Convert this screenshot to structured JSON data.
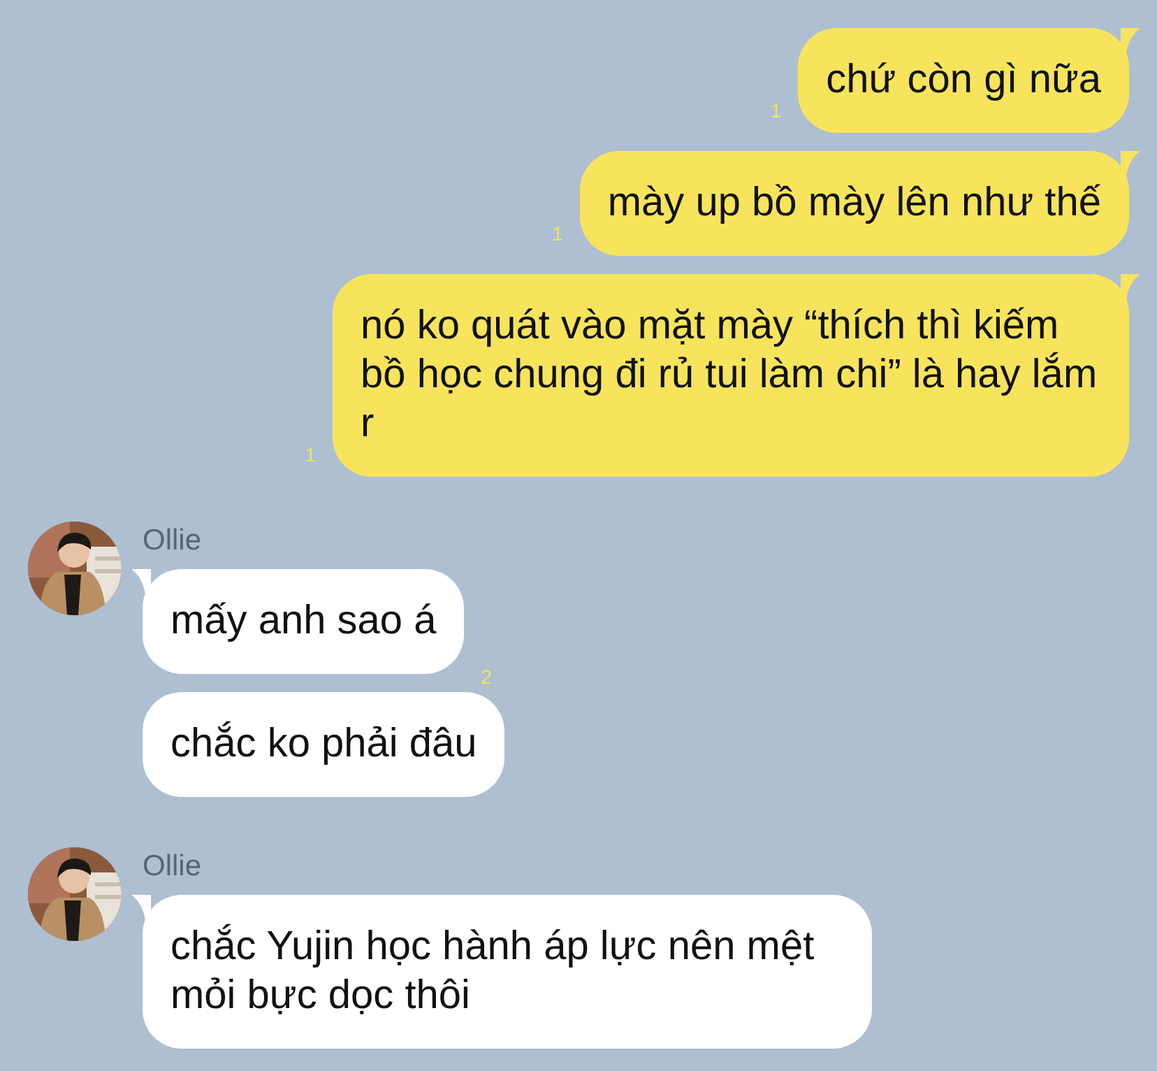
{
  "messages": [
    {
      "kind": "outgoing",
      "text": "chứ còn gì nữa",
      "read_count": "1"
    },
    {
      "kind": "outgoing",
      "text": "mày up bồ mày lên như thế",
      "read_count": "1"
    },
    {
      "kind": "outgoing",
      "text": "nó ko quát vào mặt mày “thích thì kiếm bồ học chung đi rủ tui làm chi” là hay lắm r",
      "read_count": "1"
    },
    {
      "kind": "incoming",
      "sender": "Ollie",
      "bubbles": [
        {
          "text": "mấy anh sao á",
          "read_count": "2"
        },
        {
          "text": "chắc ko phải đâu"
        }
      ]
    },
    {
      "kind": "incoming",
      "sender": "Ollie",
      "bubbles": [
        {
          "text": "chắc Yujin học hành áp lực nên mệt mỏi bực dọc thôi"
        }
      ]
    }
  ]
}
